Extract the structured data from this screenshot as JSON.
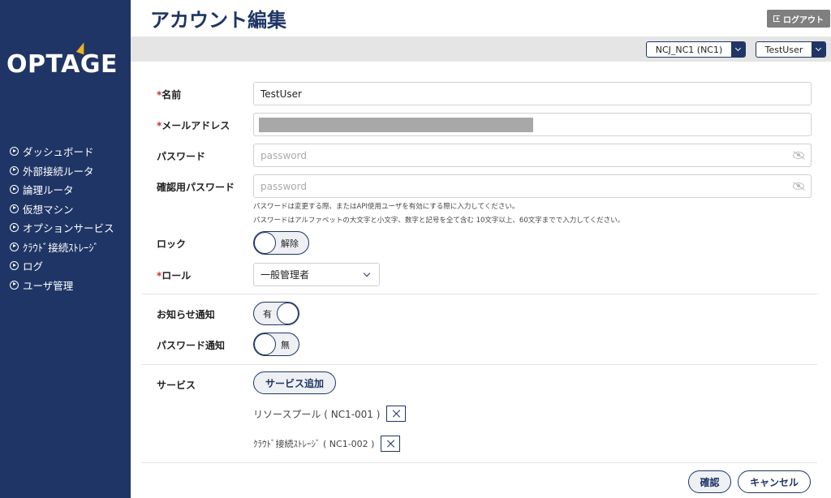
{
  "header": {
    "title": "アカウント編集",
    "logout_label": "ログアウト",
    "tenant_select": "NCJ_NC1 (NC1)",
    "user_select": "TestUser"
  },
  "sidebar": {
    "logo": "OPTAGE",
    "items": [
      {
        "label": "ダッシュボード"
      },
      {
        "label": "外部接続ルータ"
      },
      {
        "label": "論理ルータ"
      },
      {
        "label": "仮想マシン"
      },
      {
        "label": "オプションサービス"
      },
      {
        "label": "ｸﾗｳﾄﾞ接続ｽﾄﾚｰｼﾞ"
      },
      {
        "label": "ログ"
      },
      {
        "label": "ユーザ管理"
      }
    ]
  },
  "form": {
    "name": {
      "label": "名前",
      "required_mark": "*",
      "value": "TestUser"
    },
    "email": {
      "label": "メールアドレス",
      "required_mark": "*"
    },
    "password": {
      "label": "パスワード",
      "placeholder": "password"
    },
    "password_confirm": {
      "label": "確認用パスワード",
      "placeholder": "password"
    },
    "hints": [
      "パスワードは変更する際、またはAPI使用ユーザを有効にする際に入力してください。",
      "パスワードはアルファベットの大文字と小文字、数字と記号を全て含む 10文字以上、60文字までで入力してください。"
    ],
    "lock": {
      "label": "ロック",
      "toggle_label": "解除"
    },
    "role": {
      "label": "ロール",
      "required_mark": "*",
      "value": "一般管理者"
    },
    "notice": {
      "label": "お知らせ通知",
      "toggle_label": "有"
    },
    "password_notice": {
      "label": "パスワード通知",
      "toggle_label": "無"
    },
    "service": {
      "label": "サービス",
      "add_label": "サービス追加",
      "items": [
        {
          "label": "リソースプール ( NC1-001 )"
        },
        {
          "label": "ｸﾗｳﾄﾞ接続ｽﾄﾚｰｼﾞ ( NC1-002 )"
        }
      ]
    }
  },
  "footer": {
    "confirm_label": "確認",
    "cancel_label": "キャンセル"
  },
  "colors": {
    "brand_navy": "#1f3566",
    "logo_accent": "#f0b323",
    "required": "#c0392b",
    "logout_bg": "#7f7f7f",
    "subbar_bg": "#e5e5e5"
  }
}
